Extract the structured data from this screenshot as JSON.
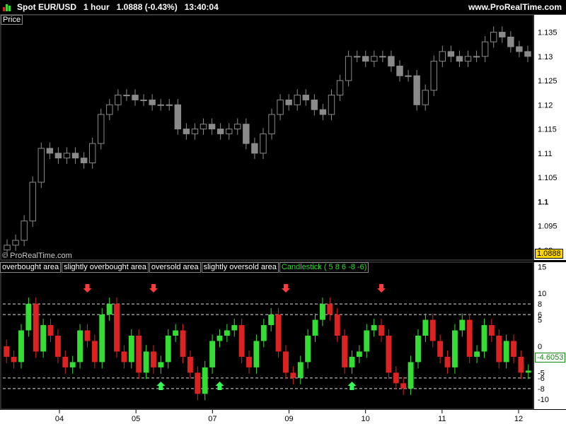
{
  "header": {
    "title": "Spot EUR/USD   1 hour   1.0888 (-0.43%)   13:40:04",
    "site": "www.ProRealTime.com"
  },
  "price_panel": {
    "label": "Price",
    "watermark": "© ProRealTime.com",
    "last_price": "1.0888",
    "last_price_bg": "#ffd700"
  },
  "indicator_panel": {
    "legend": [
      "overbought area",
      "slightly overbought area",
      "oversold area",
      "slightly oversold area"
    ],
    "candlestick_label": "Candlestick ( 5 8 6 -8 -6)",
    "last_value": "-4.6053",
    "levels": [
      8,
      6,
      -6,
      -8
    ]
  },
  "colors": {
    "up": "#33dd33",
    "down": "#dd2222",
    "price_candle": "#8a8a8a",
    "arrow_down": "#ff3b3b",
    "arrow_up": "#33ff55"
  },
  "chart_data": [
    {
      "type": "candlestick",
      "series": [
        {
          "name": "Spot EUR/USD",
          "close": [
            1.091,
            1.092,
            1.096,
            1.104,
            1.111,
            1.11,
            1.109,
            1.11,
            1.109,
            1.108,
            1.112,
            1.118,
            1.12,
            1.122,
            1.122,
            1.121,
            1.121,
            1.12,
            1.12,
            1.12,
            1.115,
            1.114,
            1.115,
            1.116,
            1.115,
            1.114,
            1.115,
            1.116,
            1.112,
            1.11,
            1.114,
            1.118,
            1.121,
            1.12,
            1.122,
            1.121,
            1.119,
            1.118,
            1.122,
            1.125,
            1.13,
            1.13,
            1.129,
            1.13,
            1.13,
            1.128,
            1.126,
            1.126,
            1.12,
            1.123,
            1.129,
            1.131,
            1.13,
            1.129,
            1.13,
            1.13,
            1.133,
            1.135,
            1.134,
            1.132,
            1.131,
            1.13
          ]
        }
      ],
      "y_ticks": [
        1.135,
        1.13,
        1.125,
        1.12,
        1.115,
        1.11,
        1.105,
        1.1,
        1.095,
        1.09
      ],
      "ylim": [
        1.0888,
        1.138
      ]
    },
    {
      "type": "candlestick",
      "series": [
        {
          "name": "Candlestick ( 5 8 6 -8 -6)",
          "close": [
            -2,
            -3,
            3,
            8,
            -1,
            4,
            2,
            -2,
            -4,
            -3,
            3,
            1,
            -3,
            6,
            8,
            -1,
            -3,
            2,
            -5,
            -1,
            -4,
            -3,
            2,
            3,
            -2,
            -5,
            -9,
            -4,
            1,
            2,
            3,
            4,
            -2,
            -4,
            1,
            4,
            6,
            -1,
            -5,
            -6,
            -3,
            2,
            5,
            8,
            6,
            2,
            -4,
            -2,
            -1,
            3,
            4,
            2,
            -5,
            -7,
            -8,
            -3,
            2,
            5,
            1,
            -2,
            -4,
            3,
            5,
            -2,
            -1,
            4,
            2,
            -3,
            1,
            -2,
            -5,
            -4.6053
          ]
        }
      ],
      "y_ticks": [
        15,
        10,
        8,
        6,
        5,
        0,
        -5,
        -6,
        -8,
        -10
      ],
      "ylim": [
        -11.5,
        15.5
      ],
      "arrows_down": [
        11,
        20,
        38,
        51
      ],
      "arrows_up": [
        21,
        29,
        47
      ]
    }
  ],
  "x_axis": {
    "labels": [
      "04",
      "05",
      "07",
      "09",
      "10",
      "11",
      "12"
    ]
  }
}
